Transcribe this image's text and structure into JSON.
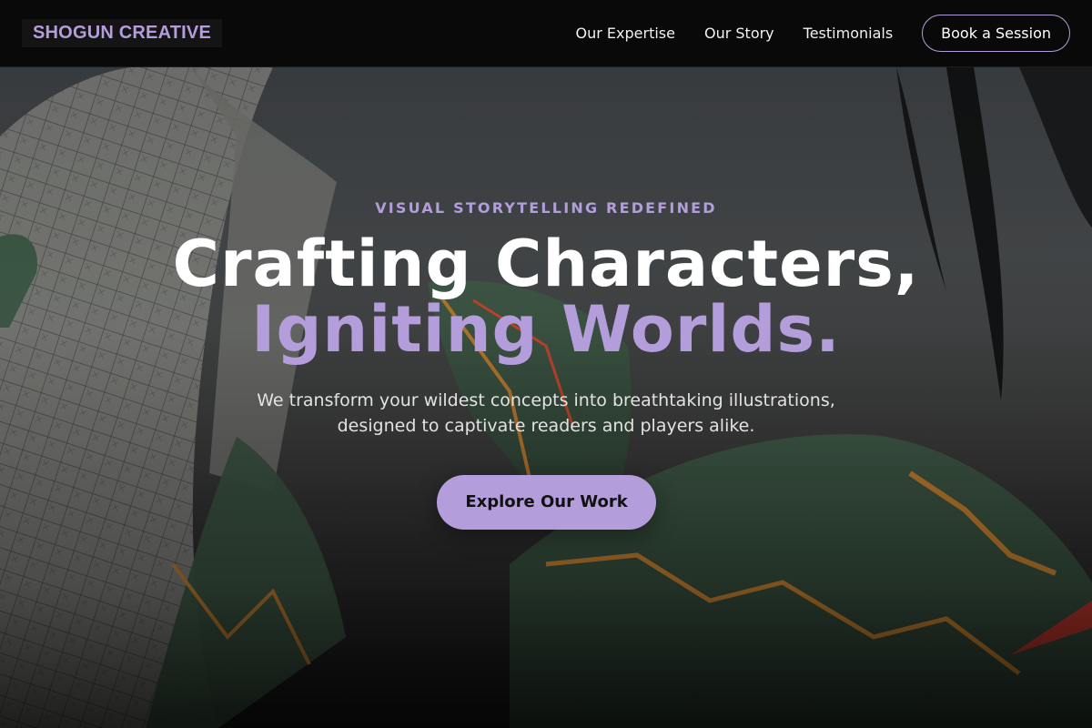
{
  "brand": {
    "name": "SHOGUN CREATIVE",
    "color": "#b39ddb"
  },
  "nav": {
    "links": [
      "Our Expertise",
      "Our Story",
      "Testimonials"
    ],
    "cta_label": "Book a Session"
  },
  "hero": {
    "eyebrow": "VISUAL STORYTELLING REDEFINED",
    "headline_line1": "Crafting Characters,",
    "headline_line2": "Igniting Worlds.",
    "subtext": "We transform your wildest concepts into breathtaking illustrations, designed to captivate readers and players alike.",
    "button_label": "Explore Our Work",
    "accent_color": "#b39ddb",
    "background_image": "illustrated-plants-artwork"
  }
}
